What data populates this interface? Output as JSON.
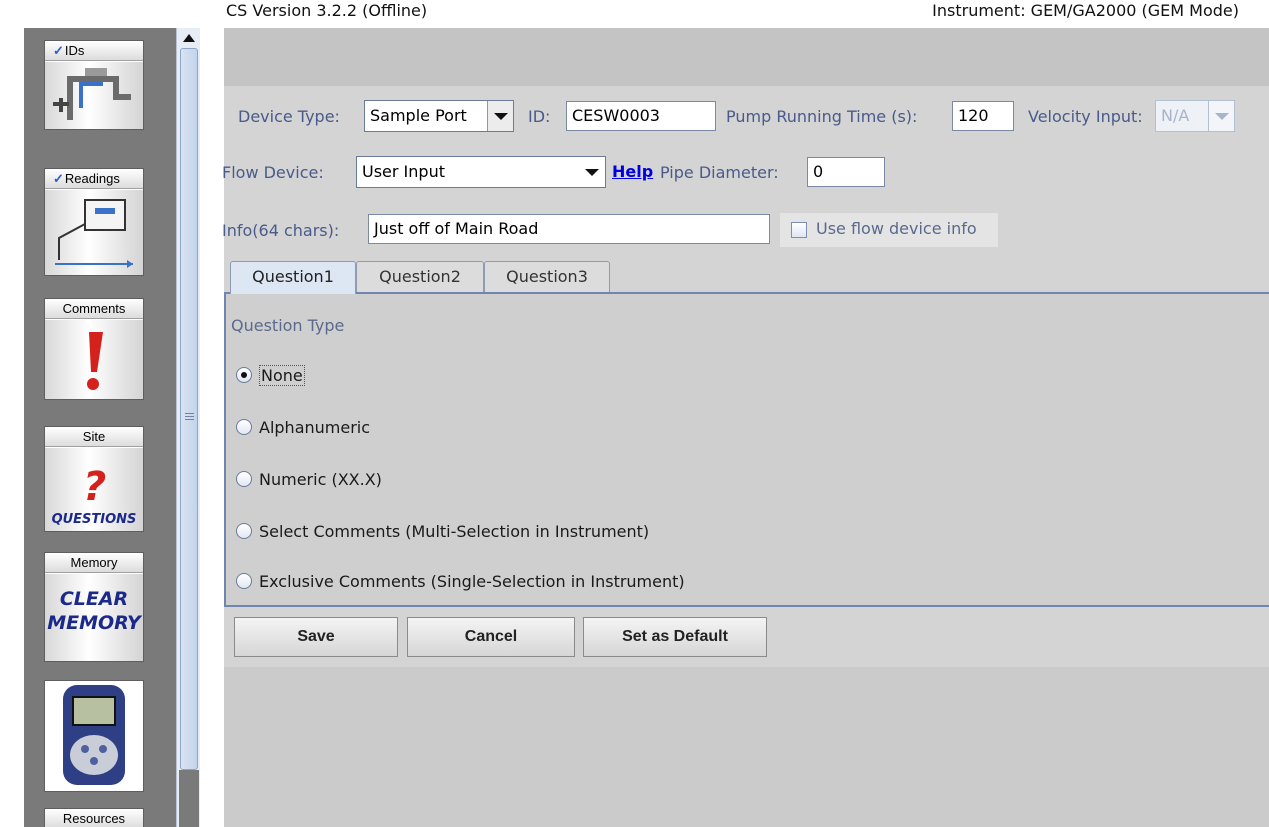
{
  "header": {
    "version": "CS Version 3.2.2 (Offline)",
    "instrument": "Instrument: GEM/GA2000 (GEM Mode)"
  },
  "sidebar": {
    "items": [
      {
        "label": "IDs",
        "icon": "pipe-icon"
      },
      {
        "label": "Readings",
        "icon": "meter-icon"
      },
      {
        "label": "Comments",
        "icon": "exclamation-icon"
      },
      {
        "label": "Site",
        "icon": "questions-icon",
        "art_text": "QUESTIONS"
      },
      {
        "label": "Memory",
        "icon": "clear-memory-icon",
        "art_text_1": "CLEAR",
        "art_text_2": "MEMORY"
      },
      {
        "label": "",
        "icon": "device-icon"
      },
      {
        "label": "Resources",
        "icon": "resources-icon"
      }
    ]
  },
  "form": {
    "device_type_label": "Device Type:",
    "device_type_value": "Sample Port",
    "id_label": "ID:",
    "id_value": "CESW0003",
    "pump_label": "Pump Running Time (s):",
    "pump_value": "120",
    "velocity_label": "Velocity Input:",
    "velocity_value": "N/A",
    "flow_device_label": "Flow Device:",
    "flow_device_value": "User Input",
    "help_link": "Help",
    "pipe_label": "Pipe Diameter:",
    "pipe_value": "0",
    "info_label": "Info(64 chars):",
    "info_value": "Just off of Main Road",
    "use_flow_label": "Use flow device info"
  },
  "tabs": [
    {
      "label": "Question1",
      "active": true
    },
    {
      "label": "Question2",
      "active": false
    },
    {
      "label": "Question3",
      "active": false
    }
  ],
  "question": {
    "type_label": "Question Type",
    "options": [
      {
        "label": "None",
        "selected": true
      },
      {
        "label": "Alphanumeric",
        "selected": false
      },
      {
        "label": "Numeric (XX.X)",
        "selected": false
      },
      {
        "label": "Select Comments (Multi-Selection in Instrument)",
        "selected": false
      },
      {
        "label": "Exclusive Comments (Single-Selection in Instrument)",
        "selected": false
      }
    ]
  },
  "buttons": {
    "save": "Save",
    "cancel": "Cancel",
    "default": "Set as Default"
  },
  "colors": {
    "label_blue": "#4a5a8a",
    "link_blue": "#0000e0",
    "tab_border": "#6f86b0"
  }
}
